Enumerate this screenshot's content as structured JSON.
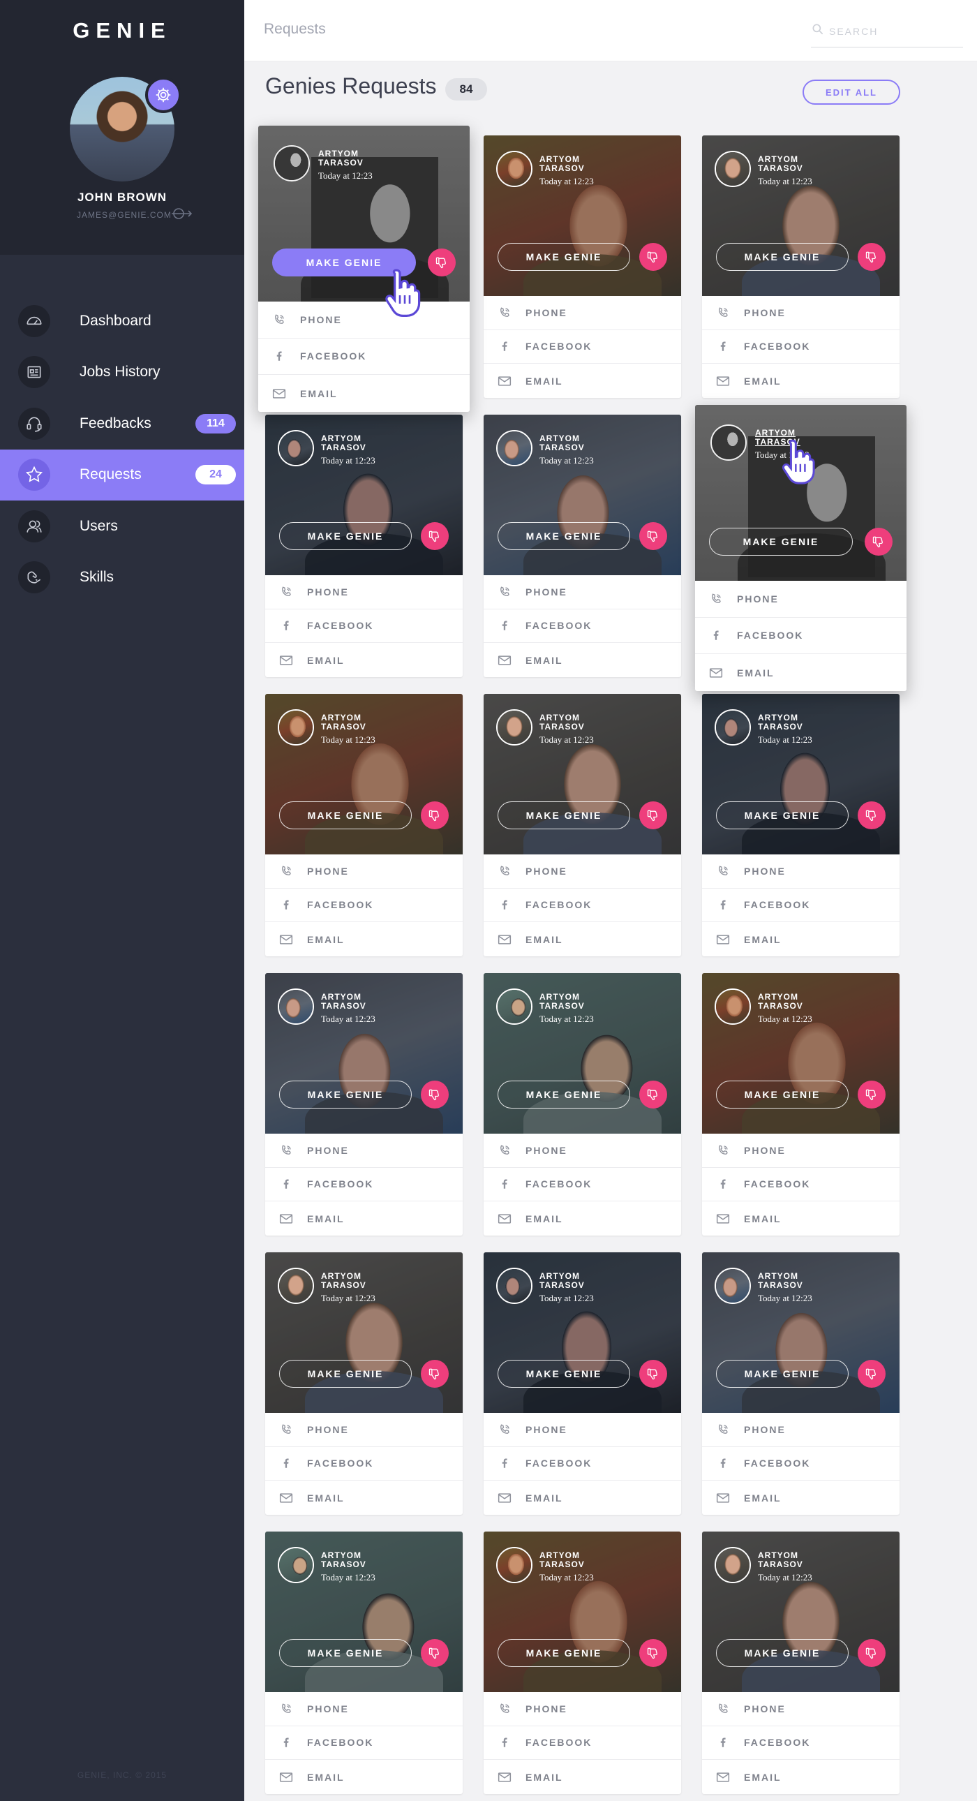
{
  "app": {
    "logo": "GENIE"
  },
  "user": {
    "name": "JOHN BROWN",
    "email": "JAMES@GENIE.COM"
  },
  "nav": [
    {
      "label": "Dashboard",
      "icon": "gauge-icon",
      "badge": "",
      "active": false
    },
    {
      "label": "Jobs History",
      "icon": "newspaper-icon",
      "badge": "",
      "active": false
    },
    {
      "label": "Feedbacks",
      "icon": "headset-icon",
      "badge": "114",
      "active": false
    },
    {
      "label": "Requests",
      "icon": "star-icon",
      "badge": "24",
      "active": true
    },
    {
      "label": "Users",
      "icon": "users-icon",
      "badge": "",
      "active": false
    },
    {
      "label": "Skills",
      "icon": "handshake-icon",
      "badge": "",
      "active": false
    }
  ],
  "copyright": "GENIE, INC. © 2015",
  "topbar": {
    "breadcrumb": "Requests",
    "search_placeholder": "SEARCH"
  },
  "header": {
    "title": "Genies Requests",
    "count": "84",
    "edit_all": "EDIT ALL"
  },
  "card_labels": {
    "make_genie": "MAKE GENIE",
    "phone": "PHONE",
    "facebook": "FACEBOOK",
    "email": "EMAIL"
  },
  "colors": {
    "accent": "#8b7cf6",
    "reject": "#ee3e7c",
    "sidebar": "#2b2f3d",
    "sidebar_top": "#232631"
  },
  "cards": [
    {
      "name": "ARTYOM TARASOV",
      "time": "Today at 12:23",
      "face": "bearded-man",
      "state": "hover-button"
    },
    {
      "name": "ARTYOM TARASOV",
      "time": "Today at 12:23",
      "face": "redhead-man",
      "state": "normal"
    },
    {
      "name": "ARTYOM TARASOV",
      "time": "Today at 12:23",
      "face": "short-hair-man",
      "state": "normal"
    },
    {
      "name": "ARTYOM TARASOV",
      "time": "Today at 12:23",
      "face": "dark-hair-woman",
      "state": "normal"
    },
    {
      "name": "ARTYOM TARASOV",
      "time": "Today at 12:23",
      "face": "glasses-woman",
      "state": "normal"
    },
    {
      "name": "ARTYOM TARASOV",
      "time": "Today at 12:23",
      "face": "bearded-man",
      "state": "hover-name"
    },
    {
      "name": "ARTYOM TARASOV",
      "time": "Today at 12:23",
      "face": "redhead-man",
      "state": "normal"
    },
    {
      "name": "ARTYOM TARASOV",
      "time": "Today at 12:23",
      "face": "short-hair-man",
      "state": "normal"
    },
    {
      "name": "ARTYOM TARASOV",
      "time": "Today at 12:23",
      "face": "dark-hair-woman",
      "state": "normal"
    },
    {
      "name": "ARTYOM TARASOV",
      "time": "Today at 12:23",
      "face": "glasses-woman",
      "state": "normal"
    },
    {
      "name": "ARTYOM TARASOV",
      "time": "Today at 12:23",
      "face": "asian-man",
      "state": "normal"
    },
    {
      "name": "ARTYOM TARASOV",
      "time": "Today at 12:23",
      "face": "redhead-man",
      "state": "normal"
    },
    {
      "name": "ARTYOM TARASOV",
      "time": "Today at 12:23",
      "face": "short-hair-man",
      "state": "normal"
    },
    {
      "name": "ARTYOM TARASOV",
      "time": "Today at 12:23",
      "face": "dark-hair-woman",
      "state": "normal"
    },
    {
      "name": "ARTYOM TARASOV",
      "time": "Today at 12:23",
      "face": "glasses-woman",
      "state": "normal"
    },
    {
      "name": "ARTYOM TARASOV",
      "time": "Today at 12:23",
      "face": "asian-man",
      "state": "normal"
    },
    {
      "name": "ARTYOM TARASOV",
      "time": "Today at 12:23",
      "face": "redhead-man",
      "state": "normal"
    },
    {
      "name": "ARTYOM TARASOV",
      "time": "Today at 12:23",
      "face": "short-hair-man",
      "state": "normal"
    }
  ]
}
